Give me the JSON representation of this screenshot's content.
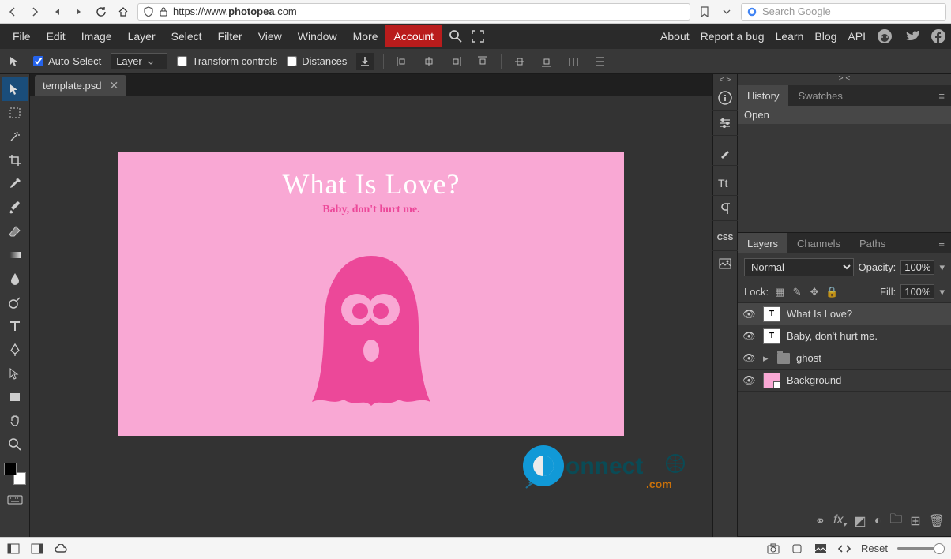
{
  "browser": {
    "url_prefix": "https://www.",
    "url_bold": "photopea",
    "url_suffix": ".com",
    "search_placeholder": "Search Google"
  },
  "menu": {
    "items": [
      "File",
      "Edit",
      "Image",
      "Layer",
      "Select",
      "Filter",
      "View",
      "Window",
      "More"
    ],
    "account": "Account",
    "right": [
      "About",
      "Report a bug",
      "Learn",
      "Blog",
      "API"
    ]
  },
  "options": {
    "auto_select": "Auto-Select",
    "layer_dd": "Layer",
    "transform": "Transform controls",
    "distances": "Distances"
  },
  "tab": {
    "filename": "template.psd"
  },
  "artwork": {
    "title": "What Is Love?",
    "subtitle": "Baby, don't hurt me."
  },
  "panels": {
    "history_tab": "History",
    "swatches_tab": "Swatches",
    "history_open": "Open",
    "layers_tab": "Layers",
    "channels_tab": "Channels",
    "paths_tab": "Paths",
    "blend_mode": "Normal",
    "opacity_label": "Opacity:",
    "opacity_value": "100%",
    "lock_label": "Lock:",
    "fill_label": "Fill:",
    "fill_value": "100%",
    "layers": [
      {
        "name": "What Is Love?",
        "type": "text",
        "selected": true
      },
      {
        "name": "Baby, don't hurt me.",
        "type": "text",
        "selected": false
      },
      {
        "name": "ghost",
        "type": "group",
        "selected": false
      },
      {
        "name": "Background",
        "type": "raster",
        "selected": false
      }
    ],
    "footer_fx": "fx"
  },
  "strip": {
    "css_label": "CSS",
    "expand_left": "< >",
    "expand_right": "> <"
  },
  "bottom": {
    "reset": "Reset"
  },
  "watermark": {
    "text1": "onnect",
    "text2": ".com"
  }
}
